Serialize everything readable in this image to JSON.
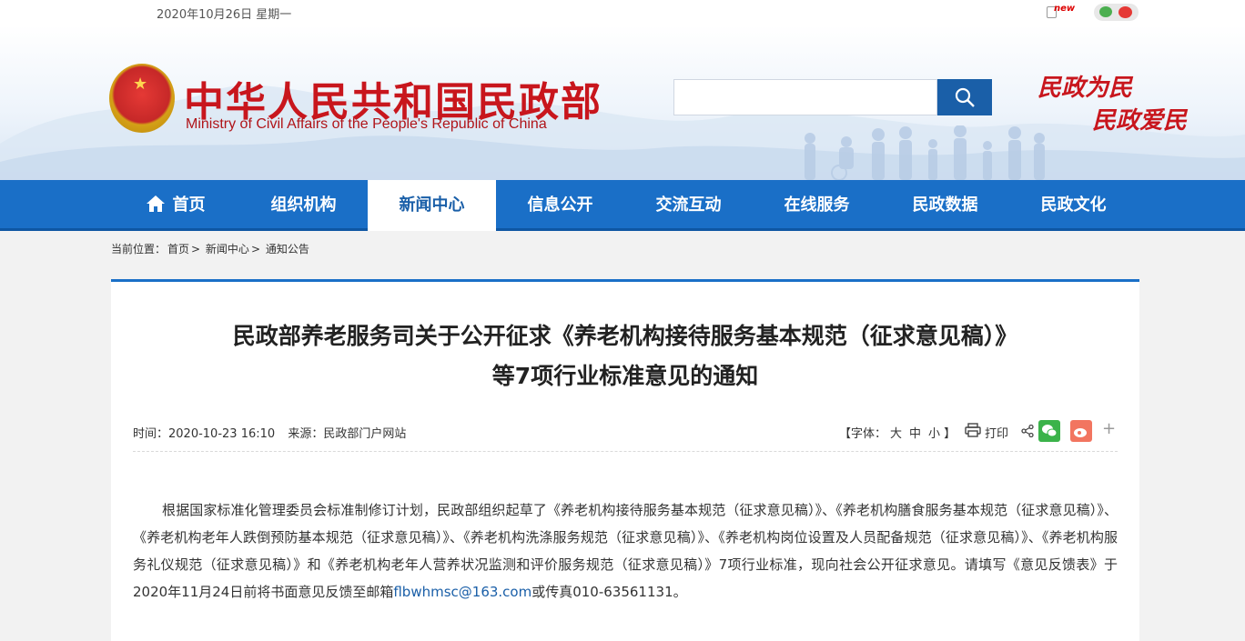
{
  "topbar": {
    "date": "2020年10月26日 星期一",
    "new_label": "new",
    "icons": [
      "new-icon",
      "wechat-icon",
      "weibo-icon"
    ]
  },
  "header": {
    "title_cn": "中华人民共和国民政部",
    "title_en": "Ministry of Civil Affairs of the People's Republic of China",
    "slogan_line1": "民政为民",
    "slogan_line2": "民政爱民",
    "search": {
      "value": "",
      "placeholder": ""
    },
    "colors": {
      "brand_red": "#c8161d",
      "brand_blue": "#1a6fc7",
      "search_blue": "#1a5fa8"
    }
  },
  "nav": {
    "items": [
      {
        "label": "首页",
        "active": false
      },
      {
        "label": "组织机构",
        "active": false
      },
      {
        "label": "新闻中心",
        "active": true
      },
      {
        "label": "信息公开",
        "active": false
      },
      {
        "label": "交流互动",
        "active": false
      },
      {
        "label": "在线服务",
        "active": false
      },
      {
        "label": "民政数据",
        "active": false
      },
      {
        "label": "民政文化",
        "active": false
      }
    ]
  },
  "breadcrumb": {
    "prefix": "当前位置：",
    "items": [
      "首页",
      "新闻中心",
      "通知公告"
    ],
    "separator": ">"
  },
  "article": {
    "title_line1": "民政部养老服务司关于公开征求《养老机构接待服务基本规范（征求意见稿）》",
    "title_line2": "等7项行业标准意见的通知",
    "time_label": "时间：",
    "time_value": "2020-10-23 16:10",
    "source_label": "来源：",
    "source_value": "民政部门户网站",
    "font_label_open": "【字体：",
    "font_sizes": [
      "大",
      "中",
      "小"
    ],
    "font_label_close": "】",
    "print_label": "打印",
    "body_before_link": "根据国家标准化管理委员会标准制修订计划，民政部组织起草了《养老机构接待服务基本规范（征求意见稿）》、《养老机构膳食服务基本规范（征求意见稿）》、《养老机构老年人跌倒预防基本规范（征求意见稿）》、《养老机构洗涤服务规范（征求意见稿）》、《养老机构岗位设置及人员配备规范（征求意见稿）》、《养老机构服务礼仪规范（征求意见稿）》和《养老机构老年人营养状况监测和评价服务规范（征求意见稿）》7项行业标准，现向社会公开征求意见。请填写《意见反馈表》于2020年11月24日前将书面意见反馈至邮箱",
    "email": "flbwhmsc@163.com",
    "body_after_link": "或传真010-63561131。"
  }
}
